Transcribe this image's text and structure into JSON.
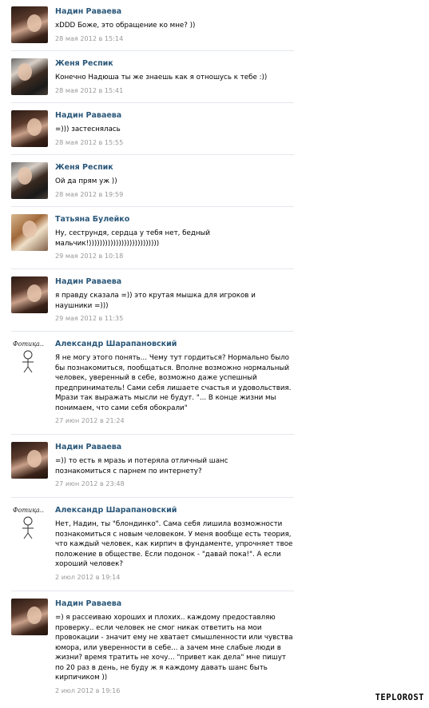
{
  "comments": [
    {
      "author": "Надин Раваева",
      "text": "xDDD Боже, это обращение ко мне? ))",
      "date": "28 мая 2012 в 15:14"
    },
    {
      "author": "Женя Респик",
      "text": "Конечно Надюша ты же знаешь как я отношусь к тебе :))",
      "date": "28 мая 2012 в 15:41"
    },
    {
      "author": "Надин Раваева",
      "text": "=))) застеснялась",
      "date": "28 мая 2012 в 15:55"
    },
    {
      "author": "Женя Респик",
      "text": "Ой да прям уж ))",
      "date": "28 мая 2012 в 19:59"
    },
    {
      "author": "Татьяна Булейко",
      "text": "Ну, сеструндя, сердца у тебя нет, бедный мальчик!))))))))))))))))))))))))))",
      "date": "29 мая 2012 в 10:18"
    },
    {
      "author": "Надин Раваева",
      "text": "я правду сказала =)) это крутая мышка для игроков и наушники =)))",
      "date": "29 мая 2012 в 11:35"
    },
    {
      "author": "Александр Шарапановский",
      "text": "Я не могу этого понять... Чему тут гордиться? Нормально было бы познакомиться, пообщаться. Вполне возможно нормальный человек, уверенный в себе, возможно даже успешный предприниматель! Сами себя лишаете счастья и удовольствия. Мрази так выражать мысли не будут. \"... В конце жизни мы понимаем, что сами себя обокрали\"",
      "date": "27 июн 2012 в 21:24"
    },
    {
      "author": "Надин Раваева",
      "text": "=)) то есть я мразь и потеряла отличный шанс познакомиться с парнем по интернету?",
      "date": "27 июн 2012 в 23:48"
    },
    {
      "author": "Александр Шарапановский",
      "text": "Нет, Надин, ты \"блондинко\". Сама себя лишила возможности познакомиться с новым человеком. У меня вообще есть теория, что каждый человек, как кирпич в фундаменте, упрочняет твое положение в обществе. Если подонок - \"давай пока!\". А если хороший человек?",
      "date": "2 июл 2012 в 19:14"
    },
    {
      "author": "Надин Раваева",
      "text": "=) я рассеиваю хороших и плохих.. каждому предоставляю проверку.. если человек не смог никак ответить на мои провокации - значит ему не хватает смышленности или чувства юмора, или уверенности в себе... а зачем мне слабые люди в жизни? время тратить не хочу... \"привет как дела\" мне пишут по 20 раз в день, не буду ж я каждому давать шанс быть кирпичиком ))",
      "date": "2 июл 2012 в 19:16"
    }
  ],
  "avatar_caption": "Фотиқа..",
  "watermark": "TEPLOROST"
}
